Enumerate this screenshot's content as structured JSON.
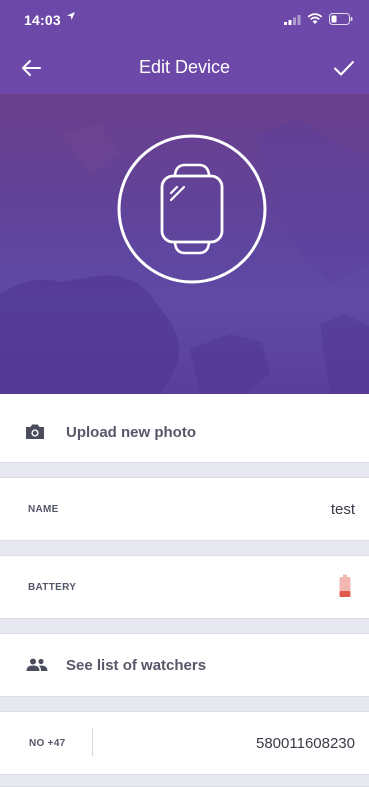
{
  "status_bar": {
    "time": "14:03"
  },
  "nav": {
    "title": "Edit Device"
  },
  "photo": {
    "upload_label": "Upload new photo"
  },
  "name_field": {
    "label": "NAME",
    "value": "test"
  },
  "battery_field": {
    "label": "BATTERY"
  },
  "watchers": {
    "label": "See list of watchers"
  },
  "phone_field": {
    "country_code": "NO +47",
    "number": "580011608230"
  },
  "colors": {
    "primary": "#6c49a8",
    "battery_low": "#e05a4f",
    "separator": "#e8e9f0"
  }
}
